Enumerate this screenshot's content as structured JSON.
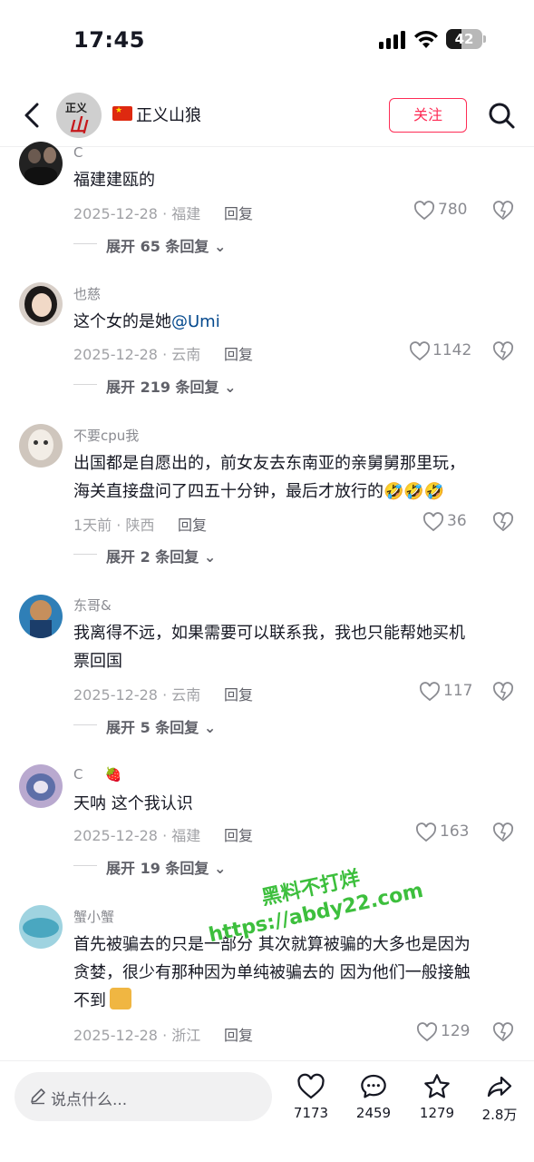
{
  "status_bar": {
    "time": "17:45",
    "battery": "42"
  },
  "header": {
    "title": "正义山狼",
    "follow_label": "关注",
    "avatar_text_top": "正义",
    "avatar_text_main": "山狼"
  },
  "comments": [
    {
      "username": "C",
      "text": "福建建瓯的",
      "date_location": "2025-12-28 · 福建",
      "reply_label": "回复",
      "likes": "780",
      "expand_label": "展开 65 条回复"
    },
    {
      "username": "也慈",
      "text": "这个女的是她",
      "mention": "@Umi",
      "date_location": "2025-12-28 · 云南",
      "reply_label": "回复",
      "likes": "1142",
      "expand_label": "展开 219 条回复"
    },
    {
      "username": "不要cpu我",
      "text_line1": "出国都是自愿出的，前女友去东南亚的亲舅舅那里玩，",
      "text_line2": "海关直接盘问了四五十分钟，最后才放行的",
      "date_location": "1天前 · 陕西",
      "reply_label": "回复",
      "likes": "36",
      "expand_label": "展开 2 条回复"
    },
    {
      "username": "东哥&",
      "text_line1": "我离得不远，如果需要可以联系我，我也只能帮她买机",
      "text_line2": "票回国",
      "date_location": "2025-12-28 · 云南",
      "reply_label": "回复",
      "likes": "117",
      "expand_label": "展开 5 条回复"
    },
    {
      "username": "C",
      "text": "天呐  这个我认识",
      "date_location": "2025-12-28 · 福建",
      "reply_label": "回复",
      "likes": "163",
      "expand_label": "展开 19 条回复"
    },
    {
      "username": "蟹小蟹",
      "text_line1": "首先被骗去的只是一部分  其次就算被骗的大多也是因为",
      "text_line2": "贪婪，很少有那种因为单纯被骗去的 因为他们一般接触",
      "text_line3": "不到",
      "date_location": "2025-12-28 · 浙江",
      "reply_label": "回复",
      "likes": "129"
    }
  ],
  "watermark": {
    "line1": "黑料不打烊",
    "line2": "https://abdy22.com"
  },
  "bottom_bar": {
    "input_placeholder": "说点什么...",
    "like_count": "7173",
    "comment_count": "2459",
    "favorite_count": "1279",
    "share_count": "2.8万"
  },
  "colors": {
    "accent": "#fe2c55",
    "mention": "#04498d",
    "muted": "#8a8b91"
  }
}
